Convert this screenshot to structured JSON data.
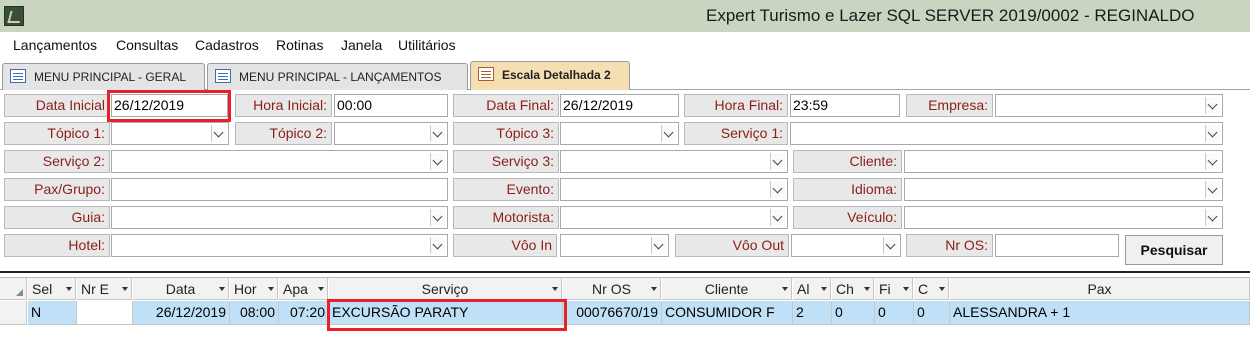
{
  "window": {
    "title": "Expert Turismo e Lazer SQL SERVER 2019/0002 - REGINALDO"
  },
  "menu": {
    "lancamentos": "Lançamentos",
    "consultas": "Consultas",
    "cadastros": "Cadastros",
    "rotinas": "Rotinas",
    "janela": "Janela",
    "utilitarios": "Utilitários"
  },
  "tabs": [
    {
      "label": "MENU PRINCIPAL - GERAL"
    },
    {
      "label": "MENU PRINCIPAL - LANÇAMENTOS"
    },
    {
      "label": "Escala Detalhada 2"
    }
  ],
  "filters": {
    "data_inicial": {
      "label": "Data Inicial",
      "value": "26/12/2019"
    },
    "hora_inicial": {
      "label": "Hora Inicial:",
      "value": "00:00"
    },
    "data_final": {
      "label": "Data Final:",
      "value": "26/12/2019"
    },
    "hora_final": {
      "label": "Hora Final:",
      "value": "23:59"
    },
    "empresa": {
      "label": "Empresa:",
      "value": ""
    },
    "topico1": {
      "label": "Tópico 1:",
      "value": ""
    },
    "topico2": {
      "label": "Tópico 2:",
      "value": ""
    },
    "topico3": {
      "label": "Tópico 3:",
      "value": ""
    },
    "servico1": {
      "label": "Serviço 1:",
      "value": ""
    },
    "servico2": {
      "label": "Serviço 2:",
      "value": ""
    },
    "servico3": {
      "label": "Serviço 3:",
      "value": ""
    },
    "cliente": {
      "label": "Cliente:",
      "value": ""
    },
    "pax_grupo": {
      "label": "Pax/Grupo:",
      "value": ""
    },
    "evento": {
      "label": "Evento:",
      "value": ""
    },
    "idioma": {
      "label": "Idioma:",
      "value": ""
    },
    "guia": {
      "label": "Guia:",
      "value": ""
    },
    "motorista": {
      "label": "Motorista:",
      "value": ""
    },
    "veiculo": {
      "label": "Veículo:",
      "value": ""
    },
    "hotel": {
      "label": "Hotel:",
      "value": ""
    },
    "voo_in": {
      "label": "Vôo In",
      "value": ""
    },
    "voo_out": {
      "label": "Vôo Out",
      "value": ""
    },
    "nr_os": {
      "label": "Nr OS:",
      "value": ""
    },
    "pesquisar_label": "Pesquisar"
  },
  "grid": {
    "columns": [
      "Sel",
      "Nr E",
      "Data",
      "Hor",
      "Apa",
      "Serviço",
      "Nr OS",
      "Cliente",
      "Al",
      "Ch",
      "Fi",
      "C",
      "Pax"
    ],
    "rows": [
      {
        "sel": "N",
        "nr_e": "",
        "data": "26/12/2019",
        "hor": "08:00",
        "apa": "07:20",
        "servico": "EXCURSÃO PARATY",
        "nr_os": "00076670/19",
        "cliente": "CONSUMIDOR F",
        "al": "2",
        "ch": "0",
        "fi": "0",
        "c": "0",
        "pax": "ALESSANDRA + 1"
      }
    ]
  },
  "colors": {
    "label_text": "#8a1f1a",
    "highlight_box": "#e8202a",
    "selected_row": "#bfe0f7",
    "active_tab": "#f5deb2"
  }
}
